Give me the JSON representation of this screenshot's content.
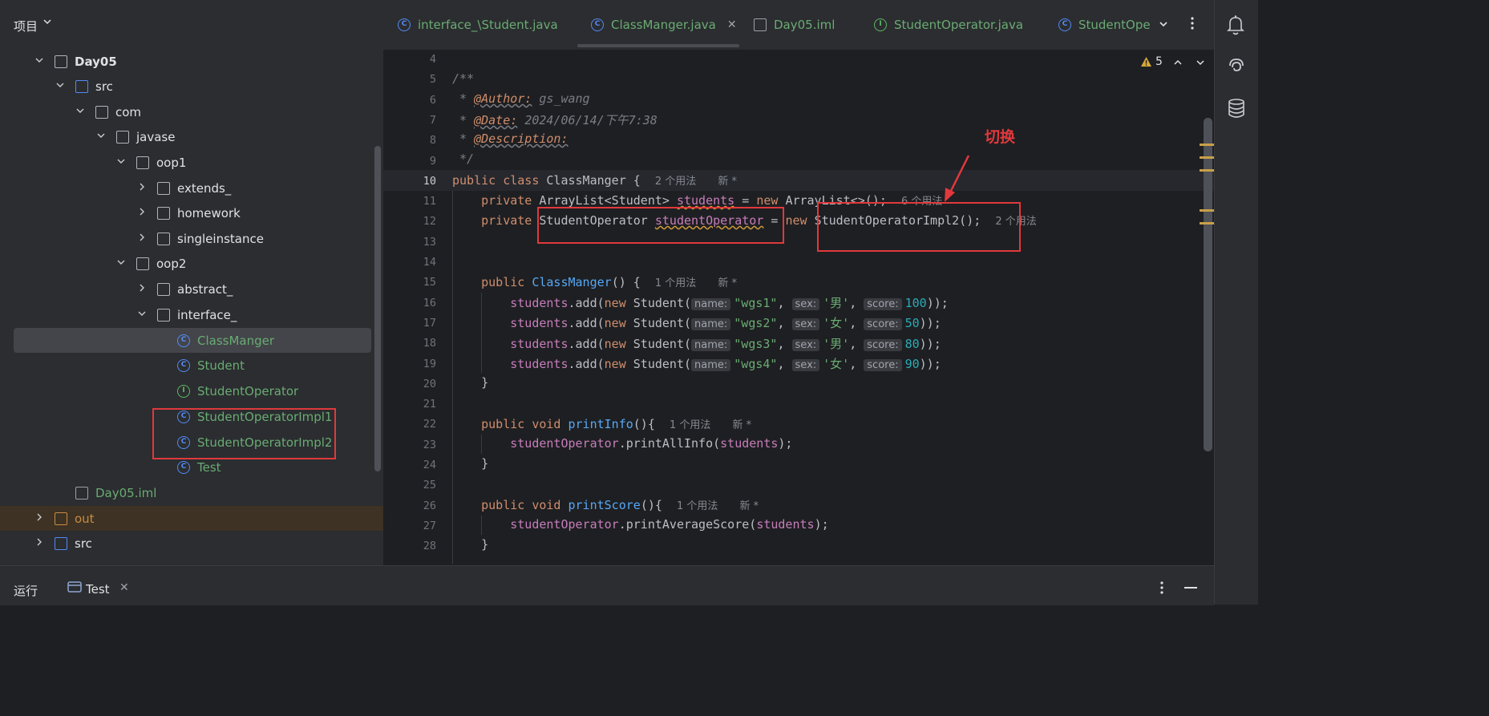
{
  "project_panel": {
    "title": "项目",
    "tree": [
      {
        "label": "Day05",
        "type": "module",
        "arrow": "down",
        "color": "#dfe1e5",
        "bold": true
      },
      {
        "label": "src",
        "type": "folder-blue",
        "arrow": "down",
        "color": "#dfe1e5"
      },
      {
        "label": "com",
        "type": "package",
        "arrow": "down",
        "color": "#dfe1e5"
      },
      {
        "label": "javase",
        "type": "package",
        "arrow": "down",
        "color": "#dfe1e5"
      },
      {
        "label": "oop1",
        "type": "package",
        "arrow": "down",
        "color": "#dfe1e5"
      },
      {
        "label": "extends_",
        "type": "package",
        "arrow": "right",
        "color": "#dfe1e5"
      },
      {
        "label": "homework",
        "type": "package",
        "arrow": "right",
        "color": "#dfe1e5"
      },
      {
        "label": "singleinstance",
        "type": "package",
        "arrow": "right",
        "color": "#dfe1e5"
      },
      {
        "label": "oop2",
        "type": "package",
        "arrow": "down",
        "color": "#dfe1e5"
      },
      {
        "label": "abstract_",
        "type": "package",
        "arrow": "right",
        "color": "#dfe1e5"
      },
      {
        "label": "interface_",
        "type": "package",
        "arrow": "down",
        "color": "#dfe1e5"
      },
      {
        "label": "ClassManger",
        "type": "class",
        "arrow": "",
        "color": "#6aab73"
      },
      {
        "label": "Student",
        "type": "class",
        "arrow": "",
        "color": "#6aab73"
      },
      {
        "label": "StudentOperator",
        "type": "interface",
        "arrow": "",
        "color": "#6aab73"
      },
      {
        "label": "StudentOperatorImpl1",
        "type": "class",
        "arrow": "",
        "color": "#6aab73"
      },
      {
        "label": "StudentOperatorImpl2",
        "type": "class",
        "arrow": "",
        "color": "#6aab73"
      },
      {
        "label": "Test",
        "type": "class-run",
        "arrow": "",
        "color": "#6aab73"
      },
      {
        "label": "Day05.iml",
        "type": "iml",
        "arrow": "",
        "color": "#6aab73"
      },
      {
        "label": "out",
        "type": "folder-orange",
        "arrow": "right",
        "color": "#c98b45"
      },
      {
        "label": "src",
        "type": "folder-blue",
        "arrow": "right",
        "color": "#dfe1e5"
      }
    ]
  },
  "tabs": [
    {
      "label": "interface_\\Student.java",
      "icon": "class-icon",
      "color": "#6aab73"
    },
    {
      "label": "ClassManger.java",
      "icon": "class-icon",
      "color": "#6aab73",
      "active": true,
      "close": "✕"
    },
    {
      "label": "Day05.iml",
      "icon": "file-icon",
      "color": "#6aab73"
    },
    {
      "label": "StudentOperator.java",
      "icon": "interface-icon",
      "color": "#6aab73"
    },
    {
      "label": "StudentOpe",
      "icon": "class-icon",
      "color": "#6aab73"
    }
  ],
  "editor": {
    "warnings_count": "5",
    "line_numbers": [
      "4",
      "5",
      "6",
      "7",
      "8",
      "9",
      "10",
      "11",
      "12",
      "13",
      "14",
      "15",
      "16",
      "17",
      "18",
      "19",
      "20",
      "21",
      "22",
      "23",
      "24",
      "25",
      "26",
      "27",
      "28"
    ],
    "doc": {
      "open": "/**",
      "author_tag": "@Author:",
      "author": "gs_wang",
      "date_tag": "@Date:",
      "date": "2024/06/14/下午7:38",
      "desc_tag": "@Description:",
      "close": "*/"
    },
    "hints": {
      "class_usages": "2 个用法",
      "class_new": "新 *",
      "students_usages": "6 个用法",
      "operator_usages": "2 个用法",
      "ctor_usages": "1 个用法",
      "ctor_new": "新 *",
      "print_info_usages": "1 个用法",
      "print_info_new": "新 *",
      "print_score_usages": "1 个用法",
      "print_score_new": "新 *"
    },
    "params": {
      "name": "name:",
      "sex": "sex:",
      "score": "score:"
    },
    "students": [
      {
        "name": "\"wgs1\"",
        "sex": "'男'",
        "score": "100"
      },
      {
        "name": "\"wgs2\"",
        "sex": "'女'",
        "score": "50"
      },
      {
        "name": "\"wgs3\"",
        "sex": "'男'",
        "score": "80"
      },
      {
        "name": "\"wgs4\"",
        "sex": "'女'",
        "score": "90"
      }
    ]
  },
  "annotation": {
    "label": "切换",
    "color": "#e0393c"
  },
  "bottom_bar": {
    "run_label": "运行",
    "run_tab": "Test"
  }
}
